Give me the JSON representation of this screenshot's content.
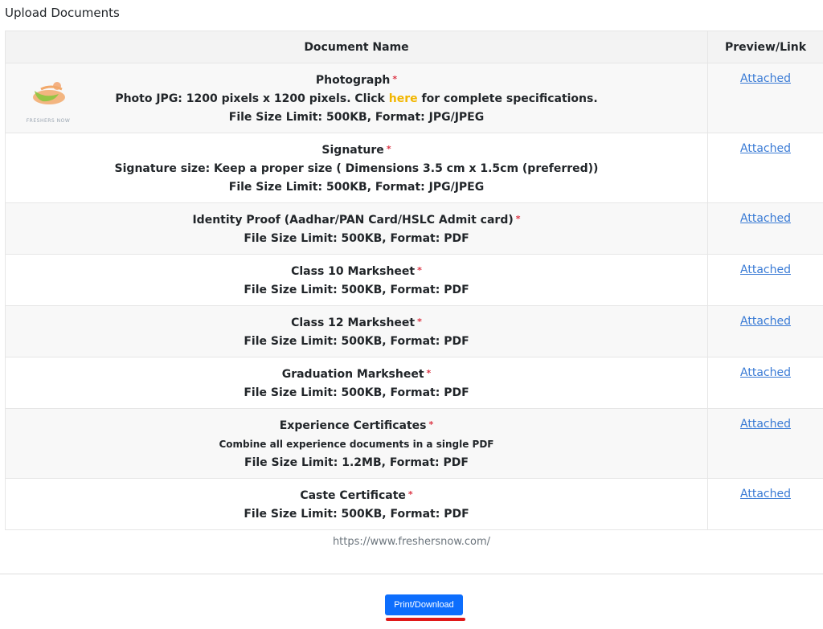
{
  "section_title": "Upload Documents",
  "table": {
    "headers": [
      "Document Name",
      "Preview/Link"
    ],
    "rows": [
      {
        "title": "Photograph",
        "required_mark": "*",
        "line2_pre": "Photo JPG: 1200 pixels x 1200 pixels. Click ",
        "line2_link": "here",
        "line2_post": " for complete specifications.",
        "line3": "File Size Limit: 500KB, Format: JPG/JPEG",
        "link": "Attached",
        "thumbnail_text": "FRESHERS NOW"
      },
      {
        "title": "Signature",
        "required_mark": "*",
        "line2": "Signature size: Keep a proper size ( Dimensions 3.5 cm x 1.5cm (preferred))",
        "line3": "File Size Limit: 500KB, Format: JPG/JPEG",
        "link": "Attached"
      },
      {
        "title": "Identity Proof (Aadhar/PAN Card/HSLC Admit card)",
        "required_mark": "*",
        "line2": "File Size Limit: 500KB, Format: PDF",
        "link": "Attached"
      },
      {
        "title": "Class 10 Marksheet",
        "required_mark": "*",
        "line2": "File Size Limit: 500KB, Format: PDF",
        "link": "Attached"
      },
      {
        "title": "Class 12 Marksheet",
        "required_mark": "*",
        "line2": "File Size Limit: 500KB, Format: PDF",
        "link": "Attached"
      },
      {
        "title": "Graduation Marksheet",
        "required_mark": "*",
        "line2": "File Size Limit: 500KB, Format: PDF",
        "link": "Attached"
      },
      {
        "title": "Experience Certificates",
        "required_mark": "*",
        "note": "Combine all experience documents in a single PDF",
        "line2": "File Size Limit: 1.2MB, Format: PDF",
        "link": "Attached"
      },
      {
        "title": "Caste Certificate",
        "required_mark": "*",
        "line2": "File Size Limit: 500KB, Format: PDF",
        "link": "Attached"
      }
    ]
  },
  "footer": {
    "url": "https://www.freshersnow.com/",
    "button_label": "Print/Download"
  },
  "colors": {
    "required": "#dc3545",
    "link": "#3a7bd5",
    "here_link": "#f2b600",
    "button": "#0d6efd",
    "annotation_underline": "#e01818"
  }
}
